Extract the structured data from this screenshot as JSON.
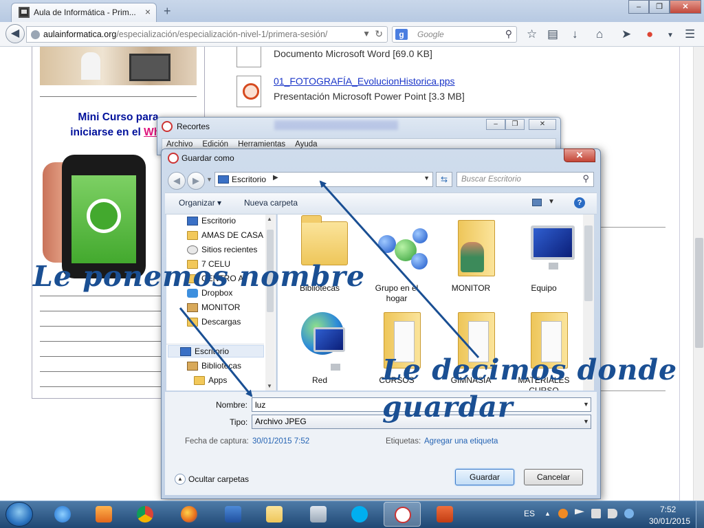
{
  "browser": {
    "tab_title": "Aula de Informática - Prim...",
    "tab_close": "×",
    "new_tab": "+",
    "url_domain": "aulainformatica.org",
    "url_path": "/especialización/especialización-nivel-1/primera-sesión/",
    "search_placeholder": "Google",
    "window_buttons": {
      "minimize": "–",
      "restore": "❐",
      "close": "✕"
    }
  },
  "page": {
    "promo_line1": "Mini Curso para",
    "promo_line2_prefix": "iniciarse en el ",
    "promo_line2_highlight": "Wha",
    "word_desc": "Documento Microsoft Word [69.0 KB]",
    "ppt_link": "01_FOTOGRAFÍA_EvolucionHistorica.pps",
    "ppt_desc": "Presentación Microsoft Power Point [3.3 MB]"
  },
  "recortes": {
    "title": "Recortes",
    "menu": [
      "Archivo",
      "Edición",
      "Herramientas",
      "Ayuda"
    ]
  },
  "dialog": {
    "title": "Guardar como",
    "close": "✕",
    "path": "Escritorio",
    "search_placeholder": "Buscar Escritorio",
    "organizar": "Organizar ▾",
    "nueva_carpeta": "Nueva carpeta",
    "help": "?",
    "tree": [
      "Escritorio",
      "AMAS DE CASA",
      "Sitios recientes",
      "7 CELU",
      "CENTRO A",
      "Dropbox",
      "MONITOR",
      "Descargas",
      "Escritorio",
      "Bibliotecas",
      "Apps"
    ],
    "items": [
      "Bibliotecas",
      "Grupo en el hogar",
      "MONITOR",
      "Equipo",
      "Red",
      "CURSOS",
      "GIMNASIA",
      "MATERIALES CURSO"
    ],
    "nombre_label": "Nombre:",
    "nombre_value": "luz",
    "tipo_label": "Tipo:",
    "tipo_value": "Archivo JPEG",
    "fecha_label": "Fecha de captura:",
    "fecha_value": "30/01/2015 7:52",
    "etiquetas_label": "Etiquetas:",
    "etiquetas_value": "Agregar una etiqueta",
    "ocultar": "Ocultar carpetas",
    "guardar": "Guardar",
    "cancelar": "Cancelar"
  },
  "annotations": {
    "nombre": "Le ponemos nombre",
    "donde_line1": "Le decimos donde",
    "donde_line2": "guardar"
  },
  "taskbar": {
    "language": "ES",
    "time": "7:52",
    "date": "30/01/2015"
  },
  "colors": {
    "annotation": "#1a4f93",
    "promo_text": "#00119b",
    "promo_highlight": "#e0127c",
    "link": "#1a35c8"
  }
}
